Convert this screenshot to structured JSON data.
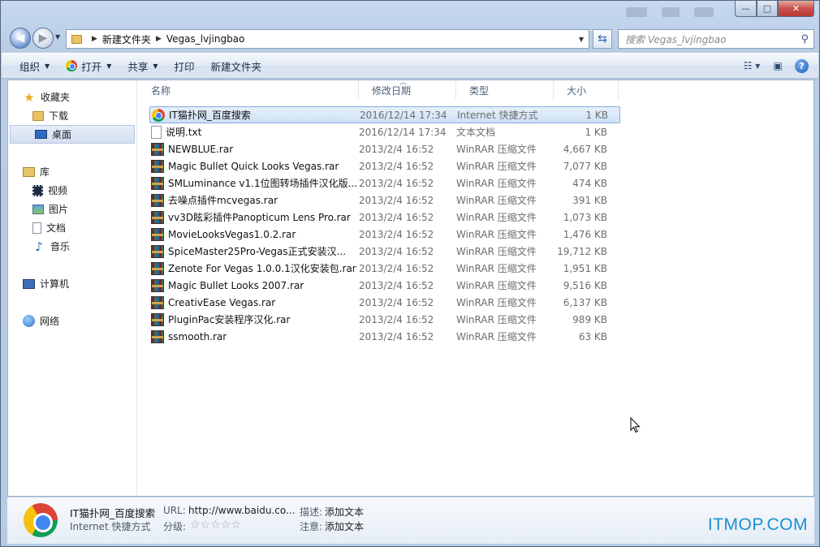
{
  "window": {
    "caption": {
      "minimize": "—",
      "maximize": "□",
      "close": "✕"
    }
  },
  "address_bar": {
    "crumbs": [
      "新建文件夹",
      "Vegas_lvjingbao"
    ]
  },
  "search": {
    "placeholder": "搜索 Vegas_lvjingbao"
  },
  "toolbar": {
    "organize": "组织",
    "open": "打开",
    "share": "共享",
    "print": "打印",
    "new_folder": "新建文件夹"
  },
  "nav": {
    "favorites": "收藏夹",
    "downloads": "下载",
    "desktop": "桌面",
    "libraries": "库",
    "videos": "视频",
    "pictures": "图片",
    "documents": "文档",
    "music": "音乐",
    "computer": "计算机",
    "network": "网络"
  },
  "columns": {
    "name": "名称",
    "date": "修改日期",
    "type": "类型",
    "size": "大小"
  },
  "files": [
    {
      "name": "IT猫扑网_百度搜索",
      "date": "2016/12/14 17:34",
      "type": "Internet 快捷方式",
      "size": "1 KB",
      "icon": "url"
    },
    {
      "name": "说明.txt",
      "date": "2016/12/14 17:34",
      "type": "文本文档",
      "size": "1 KB",
      "icon": "txt"
    },
    {
      "name": "NEWBLUE.rar",
      "date": "2013/2/4 16:52",
      "type": "WinRAR 压缩文件",
      "size": "4,667 KB",
      "icon": "rar"
    },
    {
      "name": "Magic Bullet Quick Looks Vegas.rar",
      "date": "2013/2/4 16:52",
      "type": "WinRAR 压缩文件",
      "size": "7,077 KB",
      "icon": "rar"
    },
    {
      "name": "SMLuminance v1.1位图转场插件汉化版...",
      "date": "2013/2/4 16:52",
      "type": "WinRAR 压缩文件",
      "size": "474 KB",
      "icon": "rar"
    },
    {
      "name": "去噪点插件mcvegas.rar",
      "date": "2013/2/4 16:52",
      "type": "WinRAR 压缩文件",
      "size": "391 KB",
      "icon": "rar"
    },
    {
      "name": "vv3D眩彩插件Panopticum Lens Pro.rar",
      "date": "2013/2/4 16:52",
      "type": "WinRAR 压缩文件",
      "size": "1,073 KB",
      "icon": "rar"
    },
    {
      "name": "MovieLooksVegas1.0.2.rar",
      "date": "2013/2/4 16:52",
      "type": "WinRAR 压缩文件",
      "size": "1,476 KB",
      "icon": "rar"
    },
    {
      "name": "SpiceMaster25Pro-Vegas正式安装汉...",
      "date": "2013/2/4 16:52",
      "type": "WinRAR 压缩文件",
      "size": "19,712 KB",
      "icon": "rar"
    },
    {
      "name": "Zenote For Vegas 1.0.0.1汉化安装包.rar",
      "date": "2013/2/4 16:52",
      "type": "WinRAR 压缩文件",
      "size": "1,951 KB",
      "icon": "rar"
    },
    {
      "name": "Magic Bullet Looks 2007.rar",
      "date": "2013/2/4 16:52",
      "type": "WinRAR 压缩文件",
      "size": "9,516 KB",
      "icon": "rar"
    },
    {
      "name": "CreativEase Vegas.rar",
      "date": "2013/2/4 16:52",
      "type": "WinRAR 压缩文件",
      "size": "6,137 KB",
      "icon": "rar"
    },
    {
      "name": "PluginPac安装程序汉化.rar",
      "date": "2013/2/4 16:52",
      "type": "WinRAR 压缩文件",
      "size": "989 KB",
      "icon": "rar"
    },
    {
      "name": "ssmooth.rar",
      "date": "2013/2/4 16:52",
      "type": "WinRAR 压缩文件",
      "size": "63 KB",
      "icon": "rar"
    }
  ],
  "details": {
    "title": "IT猫扑网_百度搜索",
    "subtitle": "Internet 快捷方式",
    "url_label": "URL:",
    "url_value": "http://www.baidu.co...",
    "rating_label": "分级:",
    "rating_stars": "☆☆☆☆☆",
    "desc_label": "描述:",
    "desc_value": "添加文本",
    "note_label": "注意:",
    "note_value": "添加文本"
  },
  "watermark": "ITMOP.COM"
}
